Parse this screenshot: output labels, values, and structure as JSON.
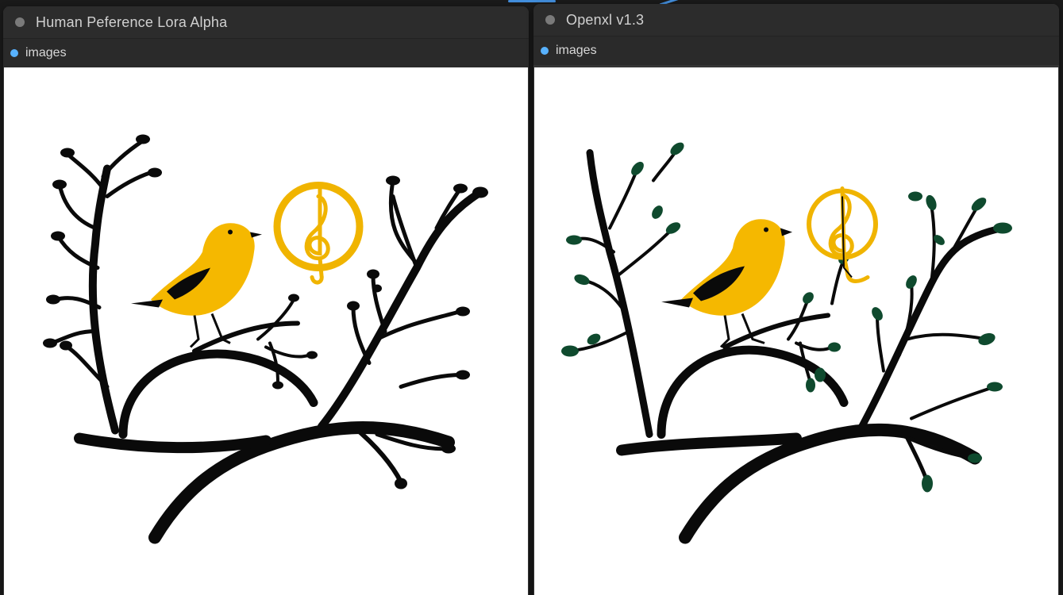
{
  "nodes": [
    {
      "title": "Human Peference Lora Alpha",
      "output_label": "images",
      "image": {
        "subject": "yellow-bird-on-branch-with-treble-clef",
        "leaf_color": "#000000"
      }
    },
    {
      "title": "Openxl v1.3",
      "output_label": "images",
      "image": {
        "subject": "yellow-bird-on-branch-with-treble-clef",
        "leaf_color": "#0f4a2e"
      }
    }
  ],
  "colors": {
    "bird_yellow": "#f5b800",
    "clef_gold": "#f0b400",
    "branch": "#0a0a0a",
    "wire": "#4aa3ff",
    "output_dot": "#58b2ff"
  }
}
